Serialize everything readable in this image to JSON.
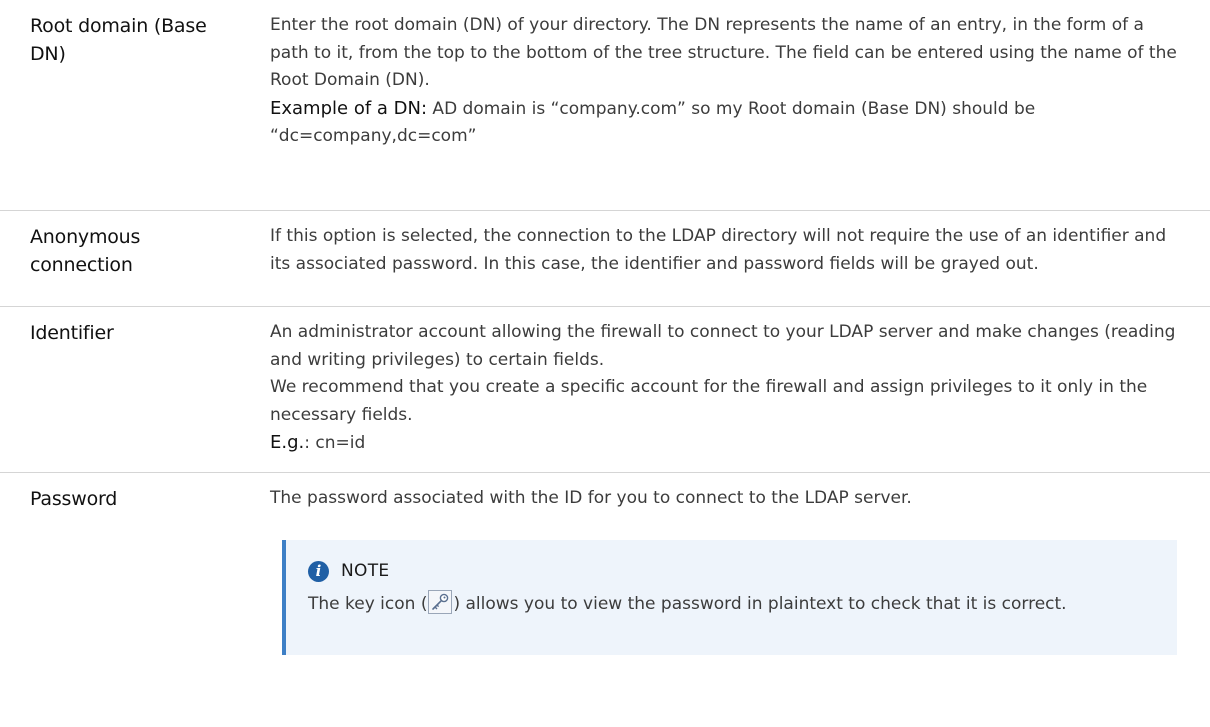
{
  "rows": [
    {
      "term": "Root domain (Base DN)",
      "text": "Enter the root domain (DN) of your directory. The DN represents the name of an entry, in the form of a path to it, from the top to the bottom of the tree structure. The field can be entered using the name of the Root Domain (DN).",
      "example_label": "Example of a DN:",
      "example_text": " AD domain is “company.com” so my Root domain (Base DN) should be “dc=company,dc=com”"
    },
    {
      "term": "Anonymous connection",
      "text": "If this option is selected, the connection to the LDAP directory will not require the use of an identifier and its associated password. In this case, the identifier and password fields will be grayed out."
    },
    {
      "term": "Identifier",
      "text": "An administrator account allowing the firewall to connect to your LDAP server and make changes (reading and writing privileges) to certain fields.",
      "text2": "We recommend that you create a specific account for the firewall and assign privileges to it only in the necessary fields.",
      "example_label": "E.g.",
      "example_text": ": cn=id"
    },
    {
      "term": "Password",
      "text": "The password associated with the ID for you to connect to the LDAP server."
    }
  ],
  "note": {
    "icon": "info-icon",
    "title": "NOTE",
    "text_before": "The key icon (",
    "key_icon": "key-icon",
    "text_after": ") allows you to view the password in plaintext to check that it is correct."
  }
}
